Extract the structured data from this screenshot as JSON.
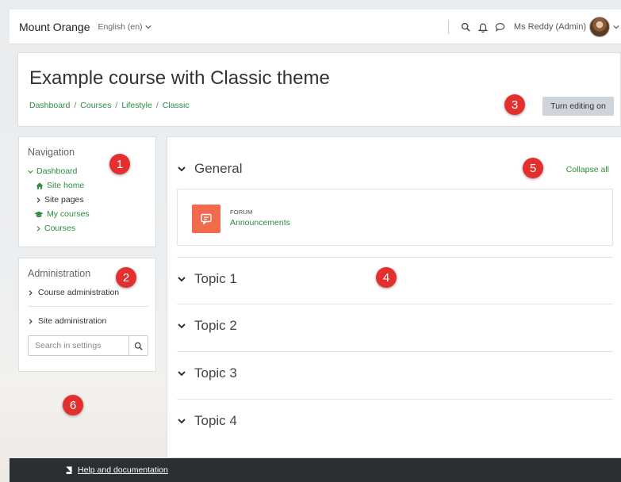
{
  "navbar": {
    "site_name": "Mount Orange",
    "language": "English (en)",
    "user_name": "Ms Reddy (Admin)",
    "icons": [
      "search-icon",
      "bell-icon",
      "message-icon"
    ]
  },
  "header": {
    "course_title": "Example course with Classic theme",
    "breadcrumb": [
      "Dashboard",
      "Courses",
      "Lifestyle",
      "Classic"
    ],
    "edit_button": "Turn editing on"
  },
  "navigation_block": {
    "title": "Navigation",
    "items": [
      {
        "label": "Dashboard",
        "icon": "chevron-down-icon"
      },
      {
        "label": "Site home",
        "icon": "home-icon"
      },
      {
        "label": "Site pages",
        "icon": "chevron-right-icon"
      },
      {
        "label": "My courses",
        "icon": "graduation-cap-icon"
      },
      {
        "label": "Courses",
        "icon": "chevron-right-icon"
      }
    ]
  },
  "administration_block": {
    "title": "Administration",
    "items": [
      {
        "label": "Course administration"
      },
      {
        "label": "Site administration"
      }
    ],
    "search_placeholder": "Search in settings"
  },
  "main": {
    "collapse_all": "Collapse all",
    "general": {
      "name": "General",
      "activity": {
        "type": "FORUM",
        "name": "Announcements"
      }
    },
    "topics": [
      "Topic 1",
      "Topic 2",
      "Topic 3",
      "Topic 4"
    ]
  },
  "footer": {
    "help_link": "Help and documentation"
  },
  "badges": [
    "1",
    "2",
    "3",
    "4",
    "5",
    "6"
  ],
  "colors": {
    "link": "#2e8b3f",
    "badge": "#e3302f",
    "forum_icon": "#f26a4d",
    "footer": "#2b2f33"
  }
}
